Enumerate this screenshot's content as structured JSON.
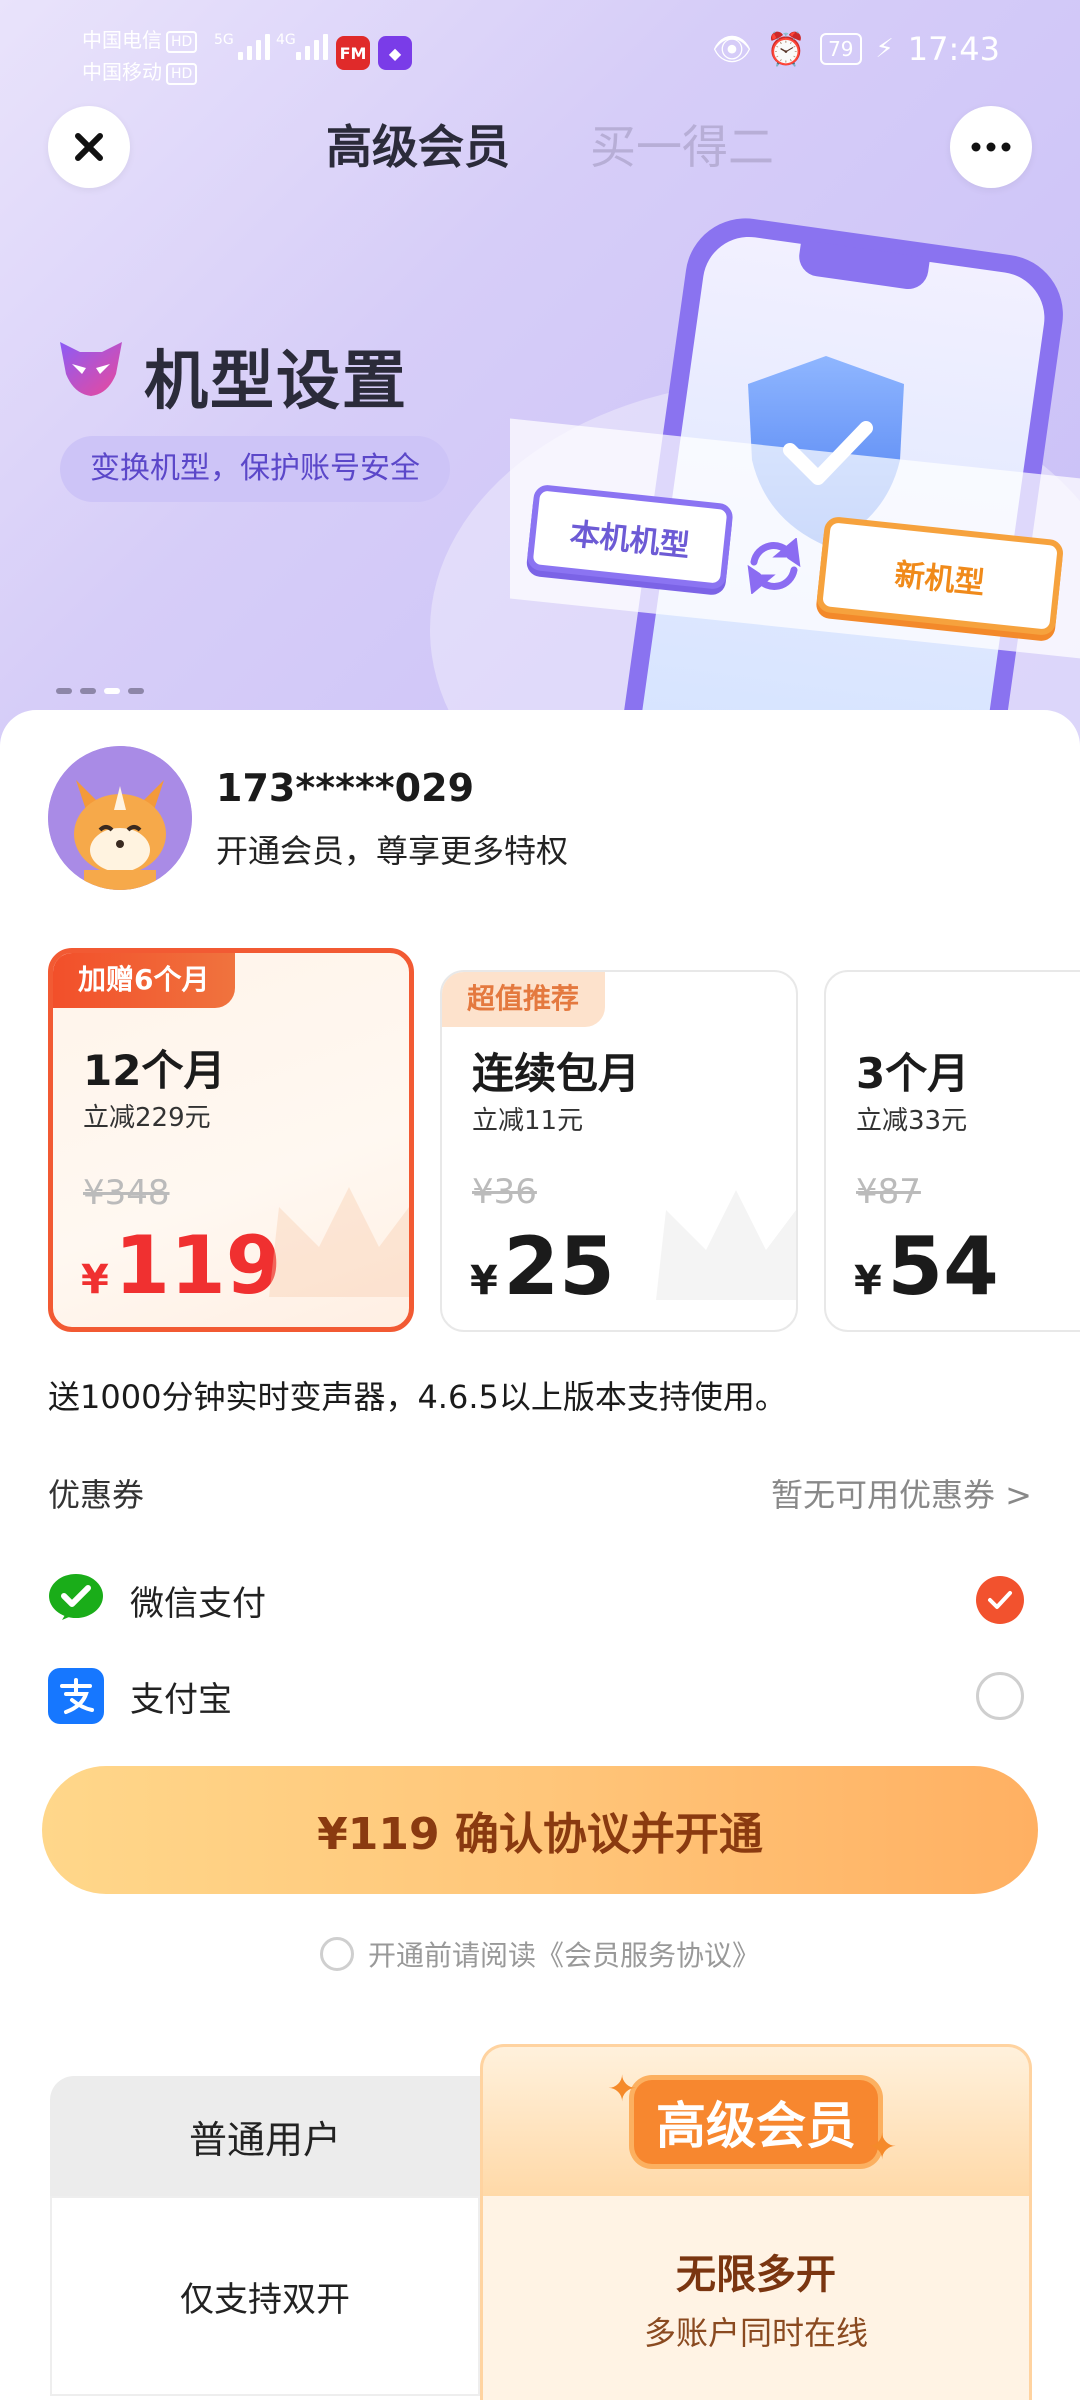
{
  "status_bar": {
    "carrier1": "中国电信",
    "carrier2": "中国移动",
    "hd": "HD",
    "net1": "5G",
    "net2": "4G",
    "battery": "79",
    "time": "17:43"
  },
  "header": {
    "tab_active": "高级会员",
    "tab_inactive": "买一得二"
  },
  "banner": {
    "title": "机型设置",
    "subtitle": "变换机型，保护账号安全",
    "tag_old": "本机机型",
    "tag_new": "新机型"
  },
  "user": {
    "name": "173*****029",
    "subtitle": "开通会员，尊享更多特权"
  },
  "plans": [
    {
      "badge": "加赠6个月",
      "name": "12个月",
      "save": "立减229元",
      "original": "¥348",
      "currency": "¥",
      "price": "119"
    },
    {
      "badge": "超值推荐",
      "name": "连续包月",
      "save": "立减11元",
      "original": "¥36",
      "currency": "¥",
      "price": "25"
    },
    {
      "badge": "",
      "name": "3个月",
      "save": "立减33元",
      "original": "¥87",
      "currency": "¥",
      "price": "54"
    }
  ],
  "gift_note": "送1000分钟实时变声器，4.6.5以上版本支持使用。",
  "coupon": {
    "label": "优惠券",
    "value": "暂无可用优惠券 >"
  },
  "payment": {
    "wechat": "微信支付",
    "alipay": "支付宝"
  },
  "cta": {
    "label": "¥119 确认协议并开通"
  },
  "agreement": {
    "label": "开通前请阅读《会员服务协议》"
  },
  "comparison": {
    "normal_header": "普通用户",
    "vip_header": "高级会员",
    "rows": [
      {
        "normal": "仅支持双开",
        "vip": "无限多开",
        "vip_sub": "多账户同时在线"
      }
    ]
  },
  "colors": {
    "accent": "#f25a33",
    "price_red": "#f03030",
    "brand_purple": "#8a73f0",
    "cta_orange": "#ffc67a"
  }
}
